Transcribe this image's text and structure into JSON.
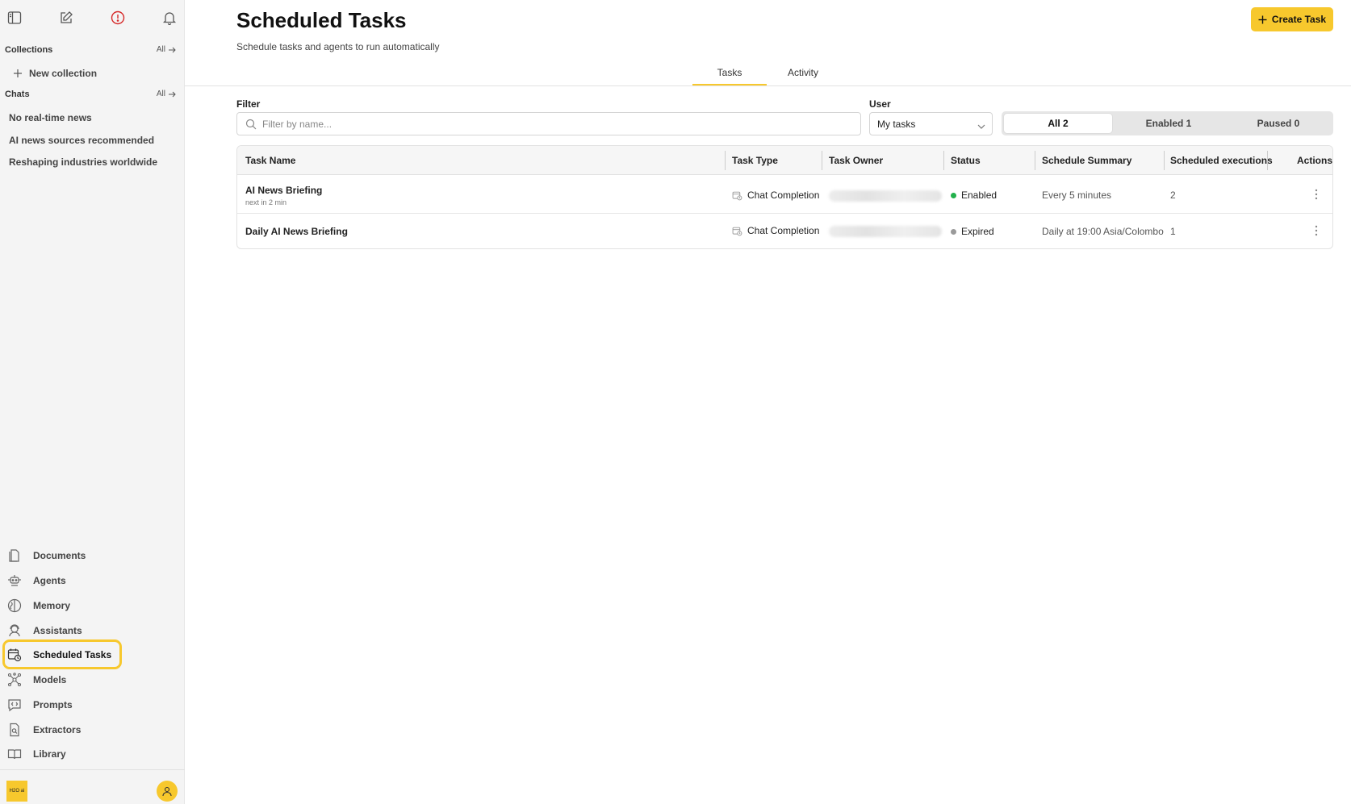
{
  "sidebar": {
    "collections": {
      "title": "Collections",
      "all": "All",
      "new_collection": "New collection"
    },
    "chats": {
      "title": "Chats",
      "all": "All",
      "items": [
        "No real-time news",
        "AI news sources recommended",
        "Reshaping industries worldwide"
      ]
    },
    "nav": [
      {
        "label": "Documents",
        "icon": "documents-icon"
      },
      {
        "label": "Agents",
        "icon": "agents-icon"
      },
      {
        "label": "Memory",
        "icon": "memory-icon"
      },
      {
        "label": "Assistants",
        "icon": "assistants-icon"
      },
      {
        "label": "Scheduled Tasks",
        "icon": "calendar-clock-icon",
        "active": true
      },
      {
        "label": "Models",
        "icon": "models-icon"
      },
      {
        "label": "Prompts",
        "icon": "prompts-icon"
      },
      {
        "label": "Extractors",
        "icon": "extractors-icon"
      },
      {
        "label": "Library",
        "icon": "library-icon"
      }
    ],
    "logo_text": "H2O ai"
  },
  "header": {
    "title": "Scheduled Tasks",
    "subtitle": "Schedule tasks and agents to run automatically",
    "create_button": "Create Task"
  },
  "tabs": [
    {
      "label": "Tasks",
      "active": true
    },
    {
      "label": "Activity",
      "active": false
    }
  ],
  "filters": {
    "filter_label": "Filter",
    "filter_placeholder": "Filter by name...",
    "user_label": "User",
    "user_value": "My tasks",
    "segments": [
      {
        "label": "All 2",
        "selected": true
      },
      {
        "label": "Enabled 1",
        "selected": false
      },
      {
        "label": "Paused 0",
        "selected": false
      }
    ]
  },
  "table": {
    "columns": [
      "Task Name",
      "Task Type",
      "Task Owner",
      "Status",
      "Schedule Summary",
      "Scheduled executions",
      "Actions"
    ],
    "rows": [
      {
        "name": "AI News Briefing",
        "next": "next in 2 min",
        "type": "Chat Completion",
        "status": "Enabled",
        "status_color": "#22b14c",
        "schedule": "Every 5 minutes",
        "executions": "2"
      },
      {
        "name": "Daily AI News Briefing",
        "next": "",
        "type": "Chat Completion",
        "status": "Expired",
        "status_color": "#9a9a9a",
        "schedule": "Daily at 19:00 Asia/Colombo",
        "executions": "1"
      }
    ]
  },
  "colors": {
    "accent": "#f7c82d",
    "enabled": "#22b14c",
    "expired": "#9a9a9a"
  }
}
